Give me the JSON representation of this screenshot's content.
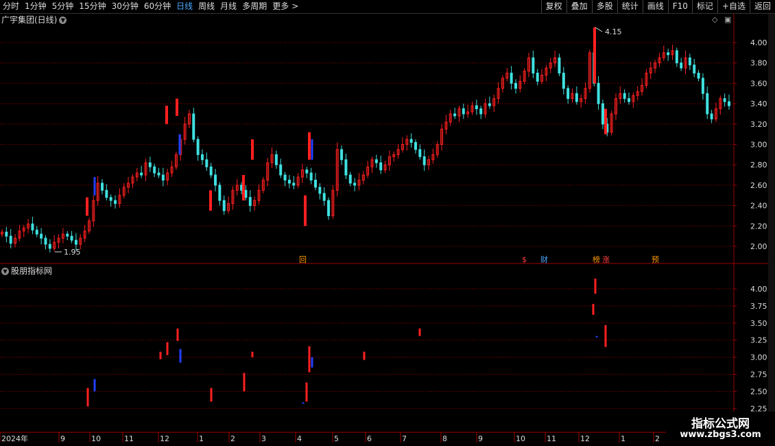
{
  "toolbar": {
    "tabs": [
      {
        "label": "分时"
      },
      {
        "label": "1分钟"
      },
      {
        "label": "5分钟"
      },
      {
        "label": "15分钟"
      },
      {
        "label": "30分钟"
      },
      {
        "label": "60分钟"
      },
      {
        "label": "日线",
        "active": true
      },
      {
        "label": "周线"
      },
      {
        "label": "月线"
      },
      {
        "label": "多周期"
      },
      {
        "label": "更多"
      }
    ],
    "more_arrow": ">",
    "tools": [
      "复权",
      "叠加",
      "多股",
      "统计",
      "画线",
      "F10",
      "标记",
      "+自选",
      "返回"
    ]
  },
  "main_chart": {
    "title": "广宇集团(日线)",
    "high_label": "4.15",
    "low_label": "1.95",
    "y_ticks": [
      "4.00",
      "3.80",
      "3.60",
      "3.40",
      "3.20",
      "3.00",
      "2.80",
      "2.60",
      "2.40",
      "2.20",
      "2.00"
    ],
    "markers": [
      {
        "text": "回",
        "color": "#ff9900"
      },
      {
        "text": "$",
        "color": "#ff4040"
      },
      {
        "text": "财",
        "color": "#4aa8ff"
      },
      {
        "text": "榜",
        "color": "#ff9900"
      },
      {
        "text": "涨",
        "color": "#ff4040"
      },
      {
        "text": "预",
        "color": "#ff9900"
      }
    ]
  },
  "sub_chart": {
    "title": "股朋指标网",
    "y_ticks": [
      "4.00",
      "3.75",
      "3.50",
      "3.25",
      "3.00",
      "2.75",
      "2.50",
      "2.25"
    ]
  },
  "x_axis": {
    "labels": [
      "2024年",
      "9",
      "10",
      "11",
      "12",
      "1",
      "2",
      "3",
      "4",
      "5",
      "6",
      "7",
      "8",
      "9",
      "10",
      "11",
      "12",
      "1",
      "2"
    ]
  },
  "watermark": {
    "line1": "指标公式网",
    "line2": "www.zbgs3.com"
  },
  "colors": {
    "up": "#ff2020",
    "down": "#40e0e0",
    "blue_bar": "#2040ff",
    "grid": "#6b0000"
  },
  "chart_data": {
    "type": "candlestick",
    "title": "广宇集团(日线)",
    "ylim": [
      1.9,
      4.2
    ],
    "x_labels": [
      "2024年",
      "9",
      "10",
      "11",
      "12",
      "1",
      "2",
      "3",
      "4",
      "5",
      "6",
      "7",
      "8",
      "9",
      "10",
      "11",
      "12",
      "1",
      "2"
    ],
    "close_series": [
      2.14,
      2.1,
      2.03,
      2.08,
      2.15,
      2.18,
      2.22,
      2.16,
      2.12,
      2.08,
      2.02,
      1.98,
      2.04,
      2.08,
      2.12,
      2.1,
      2.06,
      2.02,
      2.08,
      2.15,
      2.25,
      2.45,
      2.62,
      2.55,
      2.48,
      2.45,
      2.42,
      2.5,
      2.58,
      2.62,
      2.68,
      2.72,
      2.7,
      2.82,
      2.78,
      2.72,
      2.7,
      2.65,
      2.72,
      2.78,
      2.9,
      3.05,
      3.2,
      3.3,
      3.05,
      2.9,
      2.85,
      2.78,
      2.7,
      2.6,
      2.45,
      2.35,
      2.42,
      2.55,
      2.6,
      2.55,
      2.48,
      2.4,
      2.45,
      2.55,
      2.65,
      2.82,
      2.9,
      2.8,
      2.7,
      2.65,
      2.62,
      2.6,
      2.68,
      2.75,
      2.72,
      2.65,
      2.58,
      2.52,
      2.45,
      2.3,
      2.55,
      2.95,
      2.85,
      2.7,
      2.62,
      2.6,
      2.65,
      2.7,
      2.78,
      2.85,
      2.82,
      2.75,
      2.8,
      2.88,
      2.9,
      2.95,
      3.0,
      3.05,
      3.02,
      2.95,
      2.88,
      2.8,
      2.85,
      2.9,
      3.0,
      3.15,
      3.22,
      3.3,
      3.28,
      3.35,
      3.3,
      3.32,
      3.38,
      3.35,
      3.3,
      3.4,
      3.38,
      3.45,
      3.55,
      3.65,
      3.7,
      3.6,
      3.55,
      3.62,
      3.72,
      3.85,
      3.7,
      3.62,
      3.68,
      3.75,
      3.8,
      3.85,
      3.7,
      3.55,
      3.45,
      3.5,
      3.42,
      3.45,
      3.55,
      3.9,
      3.6,
      3.4,
      3.2,
      3.12,
      3.3,
      3.45,
      3.5,
      3.45,
      3.42,
      3.48,
      3.52,
      3.58,
      3.7,
      3.75,
      3.8,
      3.85,
      3.9,
      3.88,
      3.92,
      3.8,
      3.75,
      3.85,
      3.78,
      3.7,
      3.65,
      3.5,
      3.3,
      3.25,
      3.35,
      3.45,
      3.42,
      3.38
    ]
  }
}
